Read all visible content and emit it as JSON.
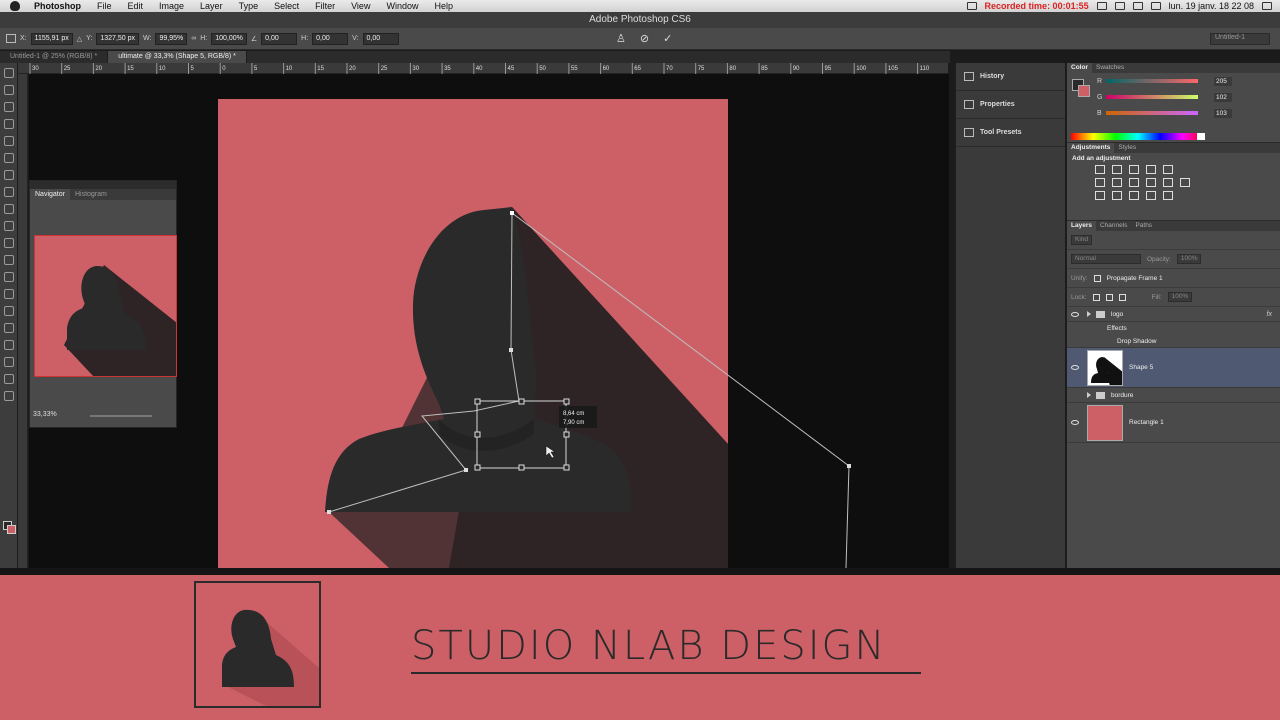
{
  "menubar": {
    "items": [
      "Photoshop",
      "File",
      "Edit",
      "Image",
      "Layer",
      "Type",
      "Select",
      "Filter",
      "View",
      "Window",
      "Help"
    ],
    "recorded": "Recorded time: 00:01:55",
    "clock": "lun. 19 janv.  18 22 08"
  },
  "app_title": "Adobe Photoshop CS6",
  "options": {
    "x_label": "X:",
    "x": "1155,91 px",
    "y_label": "Y:",
    "y": "1327,50 px",
    "w_label": "W:",
    "w": "99,95%",
    "h_label": "H:",
    "h": "100,00%",
    "angle": "0,00",
    "hskew_label": "H:",
    "hskew": "0,00",
    "vskew_label": "V:",
    "vskew": "0,00",
    "workspace": "Untitled-1"
  },
  "doc_tabs": [
    "Untitled-1 @ 25% (RGB/8) *",
    "ultimate @ 33,3% (Shape 5, RGB/8) *"
  ],
  "ruler_labels": [
    "30",
    "25",
    "20",
    "15",
    "10",
    "5",
    "0",
    "5",
    "10",
    "15",
    "20",
    "25",
    "30",
    "35",
    "40",
    "45",
    "50",
    "55",
    "60",
    "65",
    "70",
    "75",
    "80",
    "85",
    "90",
    "95",
    "100",
    "105",
    "110"
  ],
  "transform_readout": {
    "w": "8,64 cm",
    "h": "7,90 cm"
  },
  "navigator": {
    "tabs": [
      "Navigator",
      "Histogram"
    ],
    "zoom": "33,33%"
  },
  "collapsed_panels": [
    "History",
    "Properties",
    "Tool Presets"
  ],
  "color_panel": {
    "tabs": [
      "Color",
      "Swatches"
    ],
    "r_label": "R",
    "r": "205",
    "g_label": "G",
    "g": "102",
    "b_label": "B",
    "b": "103"
  },
  "adjustments": {
    "tabs": [
      "Adjustments",
      "Styles"
    ],
    "label": "Add an adjustment"
  },
  "layers_panel": {
    "tabs": [
      "Layers",
      "Channels",
      "Paths"
    ],
    "kind": "Kind",
    "blend": "Normal",
    "opacity_label": "Opacity:",
    "opacity": "100%",
    "unify_label": "Unify:",
    "propagate": "Propagate Frame 1",
    "lock_label": "Lock:",
    "fill_label": "Fill:",
    "fill": "100%",
    "fx": "fx",
    "layers": [
      "logo",
      "Effects",
      "Drop Shadow",
      "Shape 5",
      "bordure",
      "Rectangle 1"
    ]
  },
  "banner": {
    "title": "STUDIO NLAB DESIGN"
  },
  "colors": {
    "accent": "#cd6066",
    "dark": "#2b2b2b"
  }
}
